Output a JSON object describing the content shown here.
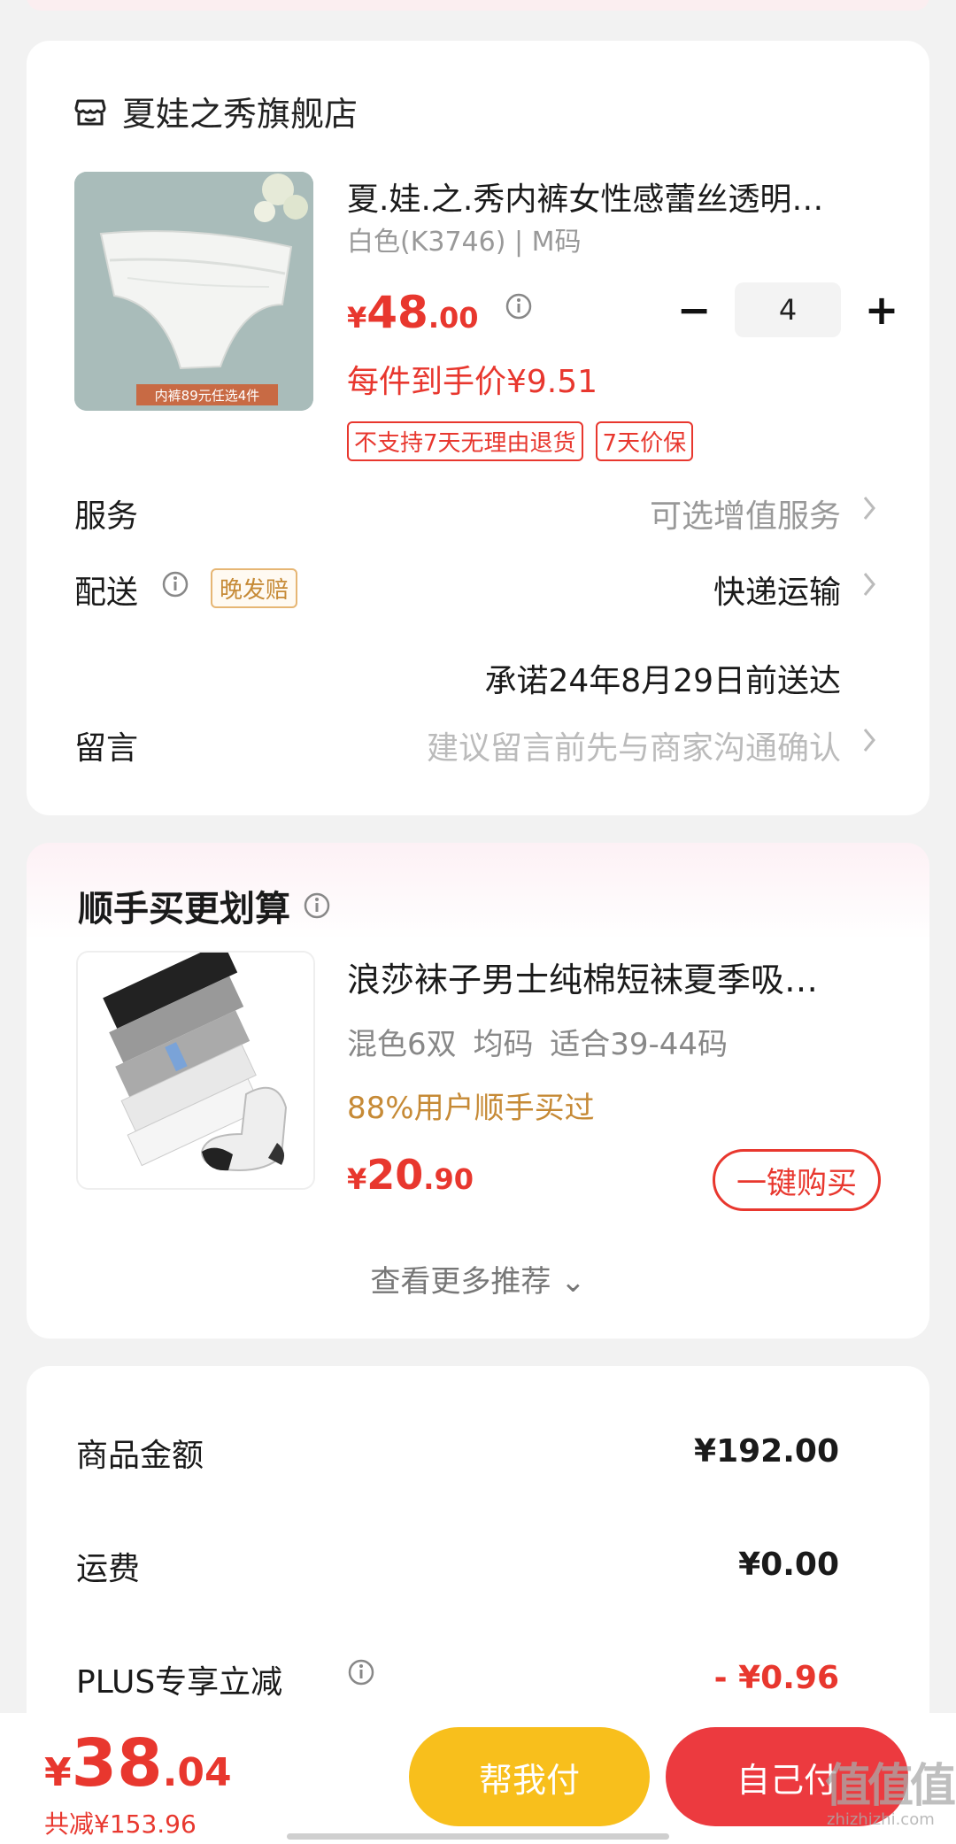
{
  "store": {
    "name": "夏娃之秀旗舰店"
  },
  "product": {
    "title": "夏.娃.之.秀内裤女性感蕾丝透明…",
    "spec": "白色(K3746) | M码",
    "price_symbol": "¥",
    "price_int": "48",
    "price_dec": ".00",
    "unit_price": "每件到手价¥9.51",
    "tags": [
      "不支持7天无理由退货",
      "7天价保"
    ],
    "quantity": "4",
    "minus_label": "−",
    "plus_label": "+",
    "image_banner": "内裤89元任选4件"
  },
  "rows": {
    "service_label": "服务",
    "service_value": "可选增值服务",
    "delivery_label": "配送",
    "late_badge": "晚发赔",
    "delivery_value": "快递运输",
    "delivery_promise": "承诺24年8月29日前送达",
    "note_label": "留言",
    "note_placeholder": "建议留言前先与商家沟通确认"
  },
  "recommend": {
    "title": "顺手买更划算",
    "name": "浪莎袜子男士纯棉短袜夏季吸…",
    "spec": "混色6双 均码 适合39-44码",
    "bought": "88%用户顺手买过",
    "price_symbol": "¥",
    "price_int": "20",
    "price_dec": ".90",
    "buy_label": "一键购买",
    "more_label": "查看更多推荐 ⌄"
  },
  "summary": {
    "goods_label": "商品金额",
    "goods_value": "¥192.00",
    "shipping_label": "运费",
    "shipping_value": "¥0.00",
    "plus_label": "PLUS专享立减",
    "plus_value": "- ¥0.96"
  },
  "bottom": {
    "total_symbol": "¥",
    "total_int": "38",
    "total_dec": ".04",
    "saved": "共减¥153.96",
    "help_pay": "帮我付",
    "self_pay": "自己付",
    "watermark": "值值值",
    "watermark_sub": "zhizhizhi.com"
  },
  "colors": {
    "accent_red": "#e8372e",
    "gold": "#c68a36",
    "help_button": "#f8bf1c",
    "pay_button": "#ec3a3f"
  }
}
